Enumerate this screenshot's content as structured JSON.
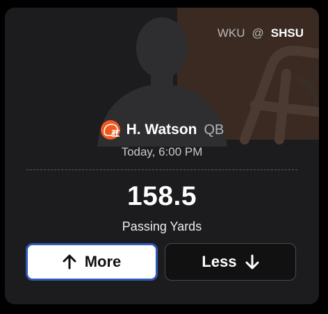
{
  "matchup": {
    "away": "WKU",
    "separator": "@",
    "home": "SHSU"
  },
  "player": {
    "name": "H. Watson",
    "position": "QB",
    "team_logo_icon": "football-helmet-icon",
    "team_color": "#f05a22"
  },
  "game": {
    "time": "Today, 6:00 PM"
  },
  "projection": {
    "line": "158.5",
    "stat": "Passing Yards"
  },
  "buttons": {
    "more_label": "More",
    "more_icon": "arrow-up-icon",
    "less_label": "Less",
    "less_icon": "arrow-down-icon",
    "selected_border_color": "#2f5bb7"
  }
}
